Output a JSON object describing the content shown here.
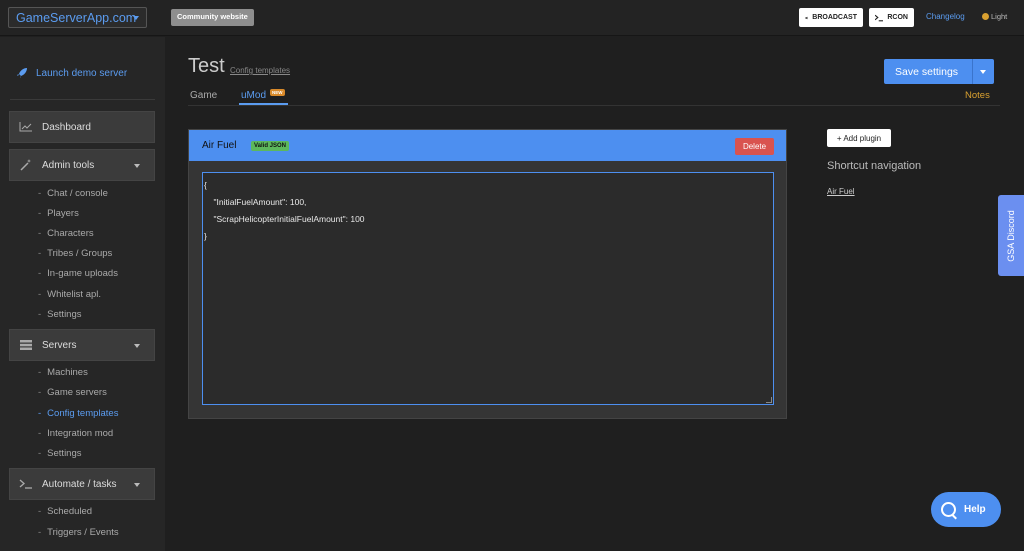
{
  "topbar": {
    "brand": "GameServerApp.com",
    "community": "Community website",
    "broadcast": "BROADCAST",
    "rcon": "RCON",
    "changelog": "Changelog",
    "theme": "Light"
  },
  "sidebar": {
    "launch": "Launch demo server",
    "dashboard": "Dashboard",
    "admin_tools": {
      "label": "Admin tools",
      "items": [
        "Chat / console",
        "Players",
        "Characters",
        "Tribes / Groups",
        "In-game uploads",
        "Whitelist apl.",
        "Settings"
      ]
    },
    "servers": {
      "label": "Servers",
      "items": [
        "Machines",
        "Game servers",
        "Config templates",
        "Integration mod",
        "Settings"
      ],
      "active": "Config templates"
    },
    "automate": {
      "label": "Automate / tasks",
      "items": [
        "Scheduled",
        "Triggers / Events"
      ]
    }
  },
  "header": {
    "title": "Test",
    "breadcrumb": "Config templates",
    "save": "Save settings",
    "tabs": [
      "Game",
      "uMod"
    ],
    "new_badge": "NEW",
    "notes": "Notes"
  },
  "plugin": {
    "name": "Air Fuel",
    "status": "Valid JSON",
    "delete": "Delete",
    "config_lines": [
      "{",
      "    \"InitialFuelAmount\": 100,",
      "    \"ScrapHelicopterInitialFuelAmount\": 100",
      "}"
    ]
  },
  "right": {
    "add_plugin": "+ Add plugin",
    "shortcut_title": "Shortcut navigation",
    "shortcut_link": "Air Fuel"
  },
  "discord": "GSA Discord",
  "help": "Help",
  "colors": {
    "accent": "#4d8ff0",
    "valid": "#5cb85c",
    "danger": "#d9534f",
    "notes": "#d9a030"
  }
}
